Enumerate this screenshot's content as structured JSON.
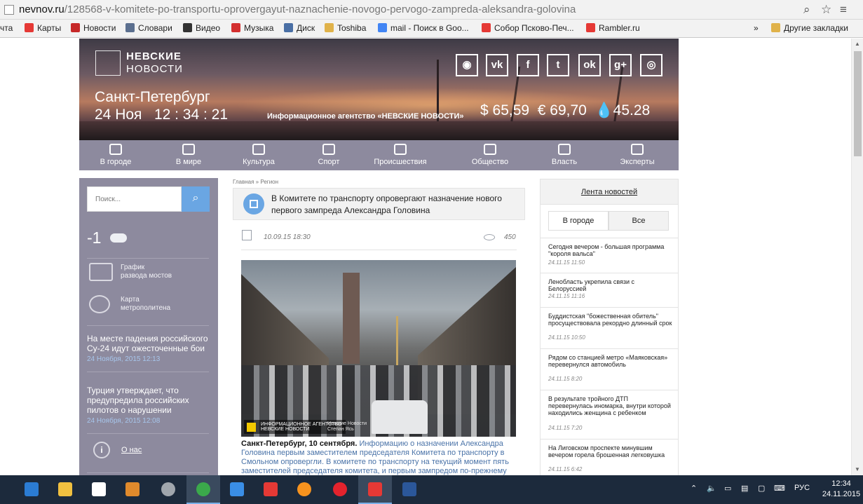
{
  "browser": {
    "url_host": "nevnov.ru",
    "url_path": "/128568-v-komitete-po-transportu-oprovergayut-naznachenie-novogo-pervogo-zampreda-aleksandra-golovina"
  },
  "bookmarks": [
    {
      "label": "чта",
      "icon": "mail-icon",
      "color": "#e04040"
    },
    {
      "label": "Карты",
      "icon": "map-pin-icon",
      "color": "#e53935"
    },
    {
      "label": "Новости",
      "icon": "news-icon",
      "color": "#c62828"
    },
    {
      "label": "Словари",
      "icon": "dictionary-icon",
      "color": "#5b6f8f"
    },
    {
      "label": "Видео",
      "icon": "video-icon",
      "color": "#333333"
    },
    {
      "label": "Музыка",
      "icon": "music-icon",
      "color": "#d32f2f"
    },
    {
      "label": "Диск",
      "icon": "disk-icon",
      "color": "#4a6fa5"
    },
    {
      "label": "Toshiba",
      "icon": "folder-icon",
      "color": "#e0b24a"
    },
    {
      "label": "mail - Поиск в Goo...",
      "icon": "google-icon",
      "color": "#4285f4"
    },
    {
      "label": "Собор Псково-Печ...",
      "icon": "yandex-icon",
      "color": "#e53935"
    },
    {
      "label": "Rambler.ru",
      "icon": "yandex-icon",
      "color": "#e53935"
    }
  ],
  "bookmarks_more": "»",
  "bookmarks_other": "Другие закладки",
  "header": {
    "logo_line1": "НЕВСКИЕ",
    "logo_line2": "НОВОСТИ",
    "city": "Санкт-Петербург",
    "date": "24 Ноя",
    "time": "12 : 34 : 21",
    "agency": "Информационное агентство «НЕВСКИЕ НОВОСТИ»",
    "usd": "$ 65,59",
    "eur": "€ 69,70",
    "oil": "45.28",
    "social": [
      {
        "name": "rss-icon",
        "glyph": "◉"
      },
      {
        "name": "vk-icon",
        "glyph": "vk"
      },
      {
        "name": "facebook-icon",
        "glyph": "f"
      },
      {
        "name": "twitter-icon",
        "glyph": "t"
      },
      {
        "name": "odnoklassniki-icon",
        "glyph": "ok"
      },
      {
        "name": "google-plus-icon",
        "glyph": "g+"
      },
      {
        "name": "instagram-icon",
        "glyph": "◎"
      }
    ]
  },
  "nav": [
    {
      "label": "В городе",
      "icon": "city-hall-icon"
    },
    {
      "label": "В мире",
      "icon": "globe-icon"
    },
    {
      "label": "Культура",
      "icon": "theatre-masks-icon"
    },
    {
      "label": "Спорт",
      "icon": "ball-icon"
    },
    {
      "label": "Происшествия",
      "icon": "siren-icon"
    },
    {
      "label": "Общество",
      "icon": "people-icon"
    },
    {
      "label": "Власть",
      "icon": "government-icon"
    },
    {
      "label": "Эксперты",
      "icon": "graduation-cap-icon"
    }
  ],
  "sidebar": {
    "search_placeholder": "Поиск...",
    "temperature": "-1",
    "bridges_line1": "График",
    "bridges_line2": "разводa мостов",
    "metro_line1": "Карта",
    "metro_line2": "метрополитена",
    "news": [
      {
        "title": "На месте падения российского Су-24 идут ожесточенные бои",
        "date": "24 Ноября, 2015 12:13"
      },
      {
        "title": "Турция утверждает, что предупредила российских пилотов о нарушении",
        "date": "24 Ноября, 2015 12:08"
      }
    ],
    "about": "О нас"
  },
  "article": {
    "breadcrumbs": "Главная » Регион",
    "title": "В Комитете по транспорту опровергают назначение нового первого зампреда Александра Головина",
    "date": "10.09.15 18:30",
    "views": "450",
    "photo_watermark_line1": "ИНФОРМАЦИОННОЕ АГЕНТСТВО",
    "photo_watermark_line2": "НЕВСКИЕ НОВОСТИ",
    "photo_credit_line1": "Невские Новости",
    "photo_credit_line2": "Степан Ясь",
    "lead": "Санкт-Петербург, 10 сентября.",
    "text": "Информацию о назначении Александра Головина первым заместителем председателя Комитета по транспорту в Смольном опровергли. В комитете по транспорту на текущий момент пять заместителей председателя комитета, и первым зампредом по-прежнему"
  },
  "feed": {
    "title": "Лента новостей",
    "tab_city": "В городе",
    "tab_all": "Все",
    "items": [
      {
        "title": "Сегодня вечером - большая программа \"короля вальса\"",
        "date": "24.11.15 11:50"
      },
      {
        "title": "Ленобласть укрепила связи с Белоруссией",
        "date": "24.11.15 11:16"
      },
      {
        "title": "Буддистская \"божественная обитель\" просуществовала рекордно длинный срок",
        "date": "24.11.15 10:50"
      },
      {
        "title": "Рядом со станцией метро «Маяковская» перевернулся автомобиль",
        "date": "24.11.15 8:20"
      },
      {
        "title": "В результате тройного ДТП перевернулась иномарка, внутри которой находились женщина с ребенком",
        "date": "24.11.15 7:20"
      },
      {
        "title": "На Лиговском проспекте минувшим вечером горела брошенная легковушка",
        "date": "24.11.15 6:42"
      }
    ]
  },
  "taskbar": {
    "apps": [
      {
        "name": "edge-icon",
        "color": "#2b7cd3"
      },
      {
        "name": "file-explorer-icon",
        "color": "#f0c040"
      },
      {
        "name": "store-icon",
        "color": "#ffffff"
      },
      {
        "name": "media-player-icon",
        "color": "#e08a2c"
      },
      {
        "name": "disc-icon",
        "color": "#a0a6ad"
      },
      {
        "name": "chrome-icon",
        "color": "#3ba94b"
      },
      {
        "name": "mail-icon",
        "color": "#3a8ee6"
      },
      {
        "name": "yandex-icon",
        "color": "#e53935"
      },
      {
        "name": "odnoklassniki-icon",
        "color": "#f7931e"
      },
      {
        "name": "opera-icon",
        "color": "#e4232d"
      },
      {
        "name": "yandex-browser-icon",
        "color": "#e53935"
      },
      {
        "name": "word-icon",
        "color": "#2b579a"
      }
    ],
    "lang": "РУС",
    "time": "12:34",
    "date": "24.11.2015"
  }
}
